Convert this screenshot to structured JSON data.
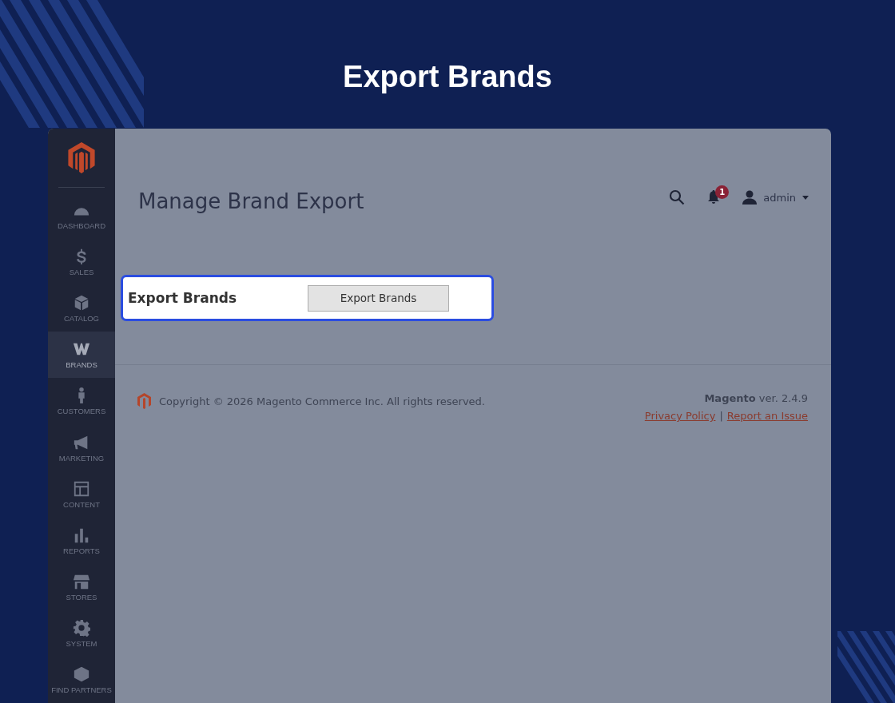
{
  "page_title": "Export Brands",
  "sidebar": {
    "items": [
      {
        "label": "DASHBOARD",
        "selected": false
      },
      {
        "label": "SALES",
        "selected": false
      },
      {
        "label": "CATALOG",
        "selected": false
      },
      {
        "label": "BRANDS",
        "selected": true
      },
      {
        "label": "CUSTOMERS",
        "selected": false
      },
      {
        "label": "MARKETING",
        "selected": false
      },
      {
        "label": "CONTENT",
        "selected": false
      },
      {
        "label": "REPORTS",
        "selected": false
      },
      {
        "label": "STORES",
        "selected": false
      },
      {
        "label": "SYSTEM",
        "selected": false
      },
      {
        "label": "FIND PARTNERS",
        "selected": false
      }
    ]
  },
  "header": {
    "title": "Manage Brand Export",
    "notification_count": "1",
    "user": "admin"
  },
  "export_panel": {
    "label": "Export Brands",
    "button": "Export Brands"
  },
  "footer": {
    "copyright": "Copyright © 2026 Magento Commerce Inc. All rights reserved.",
    "version": "**Magento** ver. 2.4.9",
    "links": [
      "Privacy Policy",
      "Report an Issue"
    ],
    "separator": "|"
  }
}
